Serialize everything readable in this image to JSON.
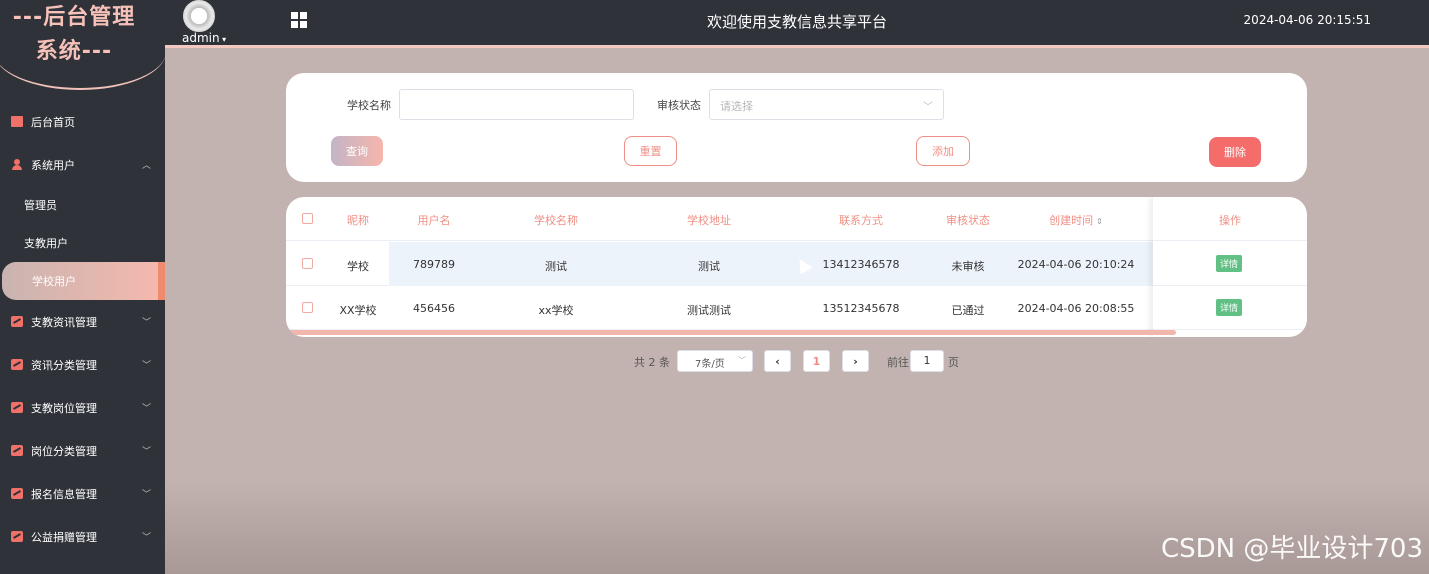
{
  "sidebar": {
    "logo_line1": "---后台管理",
    "logo_line2": "系统---",
    "items": [
      {
        "label": "后台首页",
        "icon": "monitor-icon"
      },
      {
        "label": "系统用户",
        "icon": "user-icon",
        "expanded": true,
        "children": [
          {
            "label": "管理员"
          },
          {
            "label": "支教用户"
          },
          {
            "label": "学校用户",
            "active": true
          }
        ]
      },
      {
        "label": "支教资讯管理",
        "icon": "chart-icon"
      },
      {
        "label": "资讯分类管理",
        "icon": "chart-icon"
      },
      {
        "label": "支教岗位管理",
        "icon": "chart-icon"
      },
      {
        "label": "岗位分类管理",
        "icon": "chart-icon"
      },
      {
        "label": "报名信息管理",
        "icon": "chart-icon"
      },
      {
        "label": "公益捐赠管理",
        "icon": "chart-icon"
      }
    ]
  },
  "header": {
    "username": "admin",
    "title": "欢迎使用支教信息共享平台",
    "datetime": "2024-04-06 20:15:51"
  },
  "search": {
    "school_name_label": "学校名称",
    "school_name_value": "",
    "status_label": "审核状态",
    "status_placeholder": "请选择",
    "query_label": "查询",
    "reset_label": "重置",
    "add_label": "添加",
    "delete_label": "删除"
  },
  "table": {
    "columns": [
      "昵称",
      "用户名",
      "学校名称",
      "学校地址",
      "联系方式",
      "审核状态",
      "创建时间",
      "操作"
    ],
    "rows": [
      {
        "nickname": "学校",
        "username": "789789",
        "school": "测试",
        "address": "测试",
        "phone": "13412346578",
        "status": "未审核",
        "created": "2024-04-06 20:10:24",
        "action": "详情"
      },
      {
        "nickname": "XX学校",
        "username": "456456",
        "school": "xx学校",
        "address": "测试测试",
        "phone": "13512345678",
        "status": "已通过",
        "created": "2024-04-06 20:08:55",
        "action": "详情"
      }
    ]
  },
  "pagination": {
    "total": "共 2 条",
    "page_size": "7条/页",
    "current_page": "1",
    "goto_label": "前往",
    "goto_value": "1",
    "page_suffix": "页"
  },
  "watermark": "CSDN @毕业设计703",
  "colors": {
    "accent": "#f08f84",
    "sidebar_bg": "#2f3339",
    "content_bg": "#c3b3b0",
    "delete": "#f46d6a",
    "detail": "#61c084"
  }
}
